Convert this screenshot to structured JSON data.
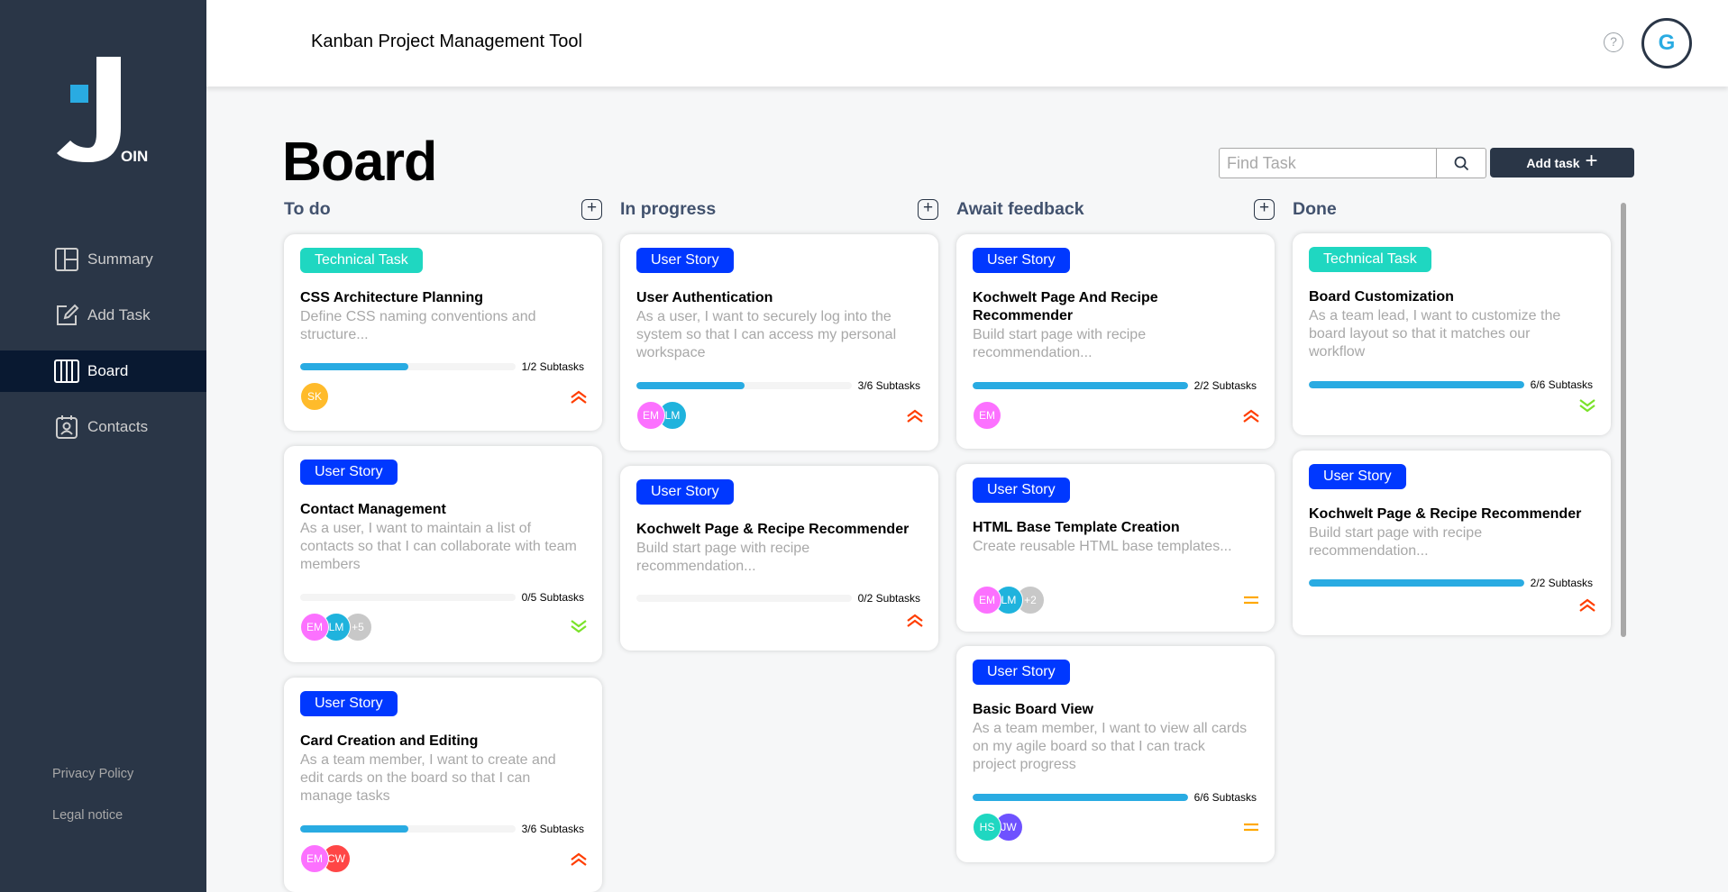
{
  "app": {
    "title": "Kanban Project Management Tool",
    "logo_text": "OIN",
    "user_initial": "G",
    "help_symbol": "?"
  },
  "sidebar": {
    "items": [
      {
        "label": "Summary",
        "icon": "summary-icon",
        "active": false
      },
      {
        "label": "Add Task",
        "icon": "add-task-icon",
        "active": false
      },
      {
        "label": "Board",
        "icon": "board-icon",
        "active": true
      },
      {
        "label": "Contacts",
        "icon": "contacts-icon",
        "active": false
      }
    ],
    "privacy": "Privacy Policy",
    "legal": "Legal notice"
  },
  "board": {
    "title": "Board",
    "search_placeholder": "Find Task",
    "search_value": "",
    "add_task_label": "Add task",
    "add_symbol": "+"
  },
  "columns": [
    {
      "title": "To do",
      "cards": [
        {
          "tag": "Technical Task",
          "tag_type": "tech",
          "title": "CSS Architecture Planning",
          "desc": "Define CSS naming conventions and structure...",
          "done": 1,
          "total": 2,
          "progress_label": "1/2 Subtasks",
          "avatars": [
            {
              "initials": "SK",
              "color": "#ffbb2b"
            }
          ],
          "priority": "urgent"
        },
        {
          "tag": "User Story",
          "tag_type": "story",
          "title": "Contact Management",
          "desc": "As a user, I want to maintain a list of contacts so that I can collaborate with team members",
          "done": 0,
          "total": 5,
          "progress_label": "0/5 Subtasks",
          "avatars": [
            {
              "initials": "EM",
              "color": "#fc71ff"
            },
            {
              "initials": "LM",
              "color": "#1fb3dd"
            },
            {
              "initials": "+5",
              "color": "#c8c8c8"
            }
          ],
          "priority": "low"
        },
        {
          "tag": "User Story",
          "tag_type": "story",
          "title": "Card Creation and Editing",
          "desc": "As a team member, I want to create and edit cards on the board so that I can manage tasks",
          "done": 3,
          "total": 6,
          "progress_label": "3/6 Subtasks",
          "avatars": [
            {
              "initials": "EM",
              "color": "#fc71ff"
            },
            {
              "initials": "CW",
              "color": "#ff4646"
            }
          ],
          "priority": "urgent"
        }
      ]
    },
    {
      "title": "In progress",
      "cards": [
        {
          "tag": "User Story",
          "tag_type": "story",
          "title": "User Authentication",
          "desc": "As a user, I want to securely log into the system so that I can access my personal workspace",
          "done": 3,
          "total": 6,
          "progress_label": "3/6 Subtasks",
          "avatars": [
            {
              "initials": "EM",
              "color": "#fc71ff"
            },
            {
              "initials": "LM",
              "color": "#1fb3dd"
            }
          ],
          "priority": "urgent"
        },
        {
          "tag": "User Story",
          "tag_type": "story",
          "title": "Kochwelt Page & Recipe Recommender",
          "desc": "Build start page with recipe recommendation...",
          "done": 0,
          "total": 2,
          "progress_label": "0/2 Subtasks",
          "avatars": [],
          "priority": "urgent"
        }
      ]
    },
    {
      "title": "Await feedback",
      "cards": [
        {
          "tag": "User Story",
          "tag_type": "story",
          "title": "Kochwelt Page And Recipe Recommender",
          "desc": "Build start page with recipe recommendation...",
          "done": 2,
          "total": 2,
          "progress_label": "2/2 Subtasks",
          "avatars": [
            {
              "initials": "EM",
              "color": "#fc71ff"
            }
          ],
          "priority": "urgent"
        },
        {
          "tag": "User Story",
          "tag_type": "story",
          "title": "HTML Base Template Creation",
          "desc": "Create reusable HTML base templates...",
          "done": null,
          "total": null,
          "progress_label": "",
          "avatars": [
            {
              "initials": "EM",
              "color": "#fc71ff"
            },
            {
              "initials": "LM",
              "color": "#1fb3dd"
            },
            {
              "initials": "+2",
              "color": "#c8c8c8"
            }
          ],
          "priority": "medium"
        },
        {
          "tag": "User Story",
          "tag_type": "story",
          "title": "Basic Board View",
          "desc": "As a team member, I want to view all cards on my agile board so that I can track project progress",
          "done": 6,
          "total": 6,
          "progress_label": "6/6 Subtasks",
          "avatars": [
            {
              "initials": "HS",
              "color": "#1fd7c1"
            },
            {
              "initials": "JW",
              "color": "#6e52ff"
            }
          ],
          "priority": "medium"
        }
      ]
    },
    {
      "title": "Done",
      "cards": [
        {
          "tag": "Technical Task",
          "tag_type": "tech",
          "title": "Board Customization",
          "desc": "As a team lead, I want to customize the board layout so that it matches our workflow",
          "done": 6,
          "total": 6,
          "progress_label": "6/6 Subtasks",
          "avatars": [],
          "priority": "low"
        },
        {
          "tag": "User Story",
          "tag_type": "story",
          "title": "Kochwelt Page & Recipe Recommender",
          "desc": "Build start page with recipe recommendation...",
          "done": 2,
          "total": 2,
          "progress_label": "2/2 Subtasks",
          "avatars": [],
          "priority": "urgent"
        }
      ]
    }
  ],
  "colors": {
    "sidebar": "#2a3647",
    "accent": "#29abe2",
    "urgent": "#ff3d00",
    "medium": "#ffa800",
    "low": "#7ae229"
  }
}
